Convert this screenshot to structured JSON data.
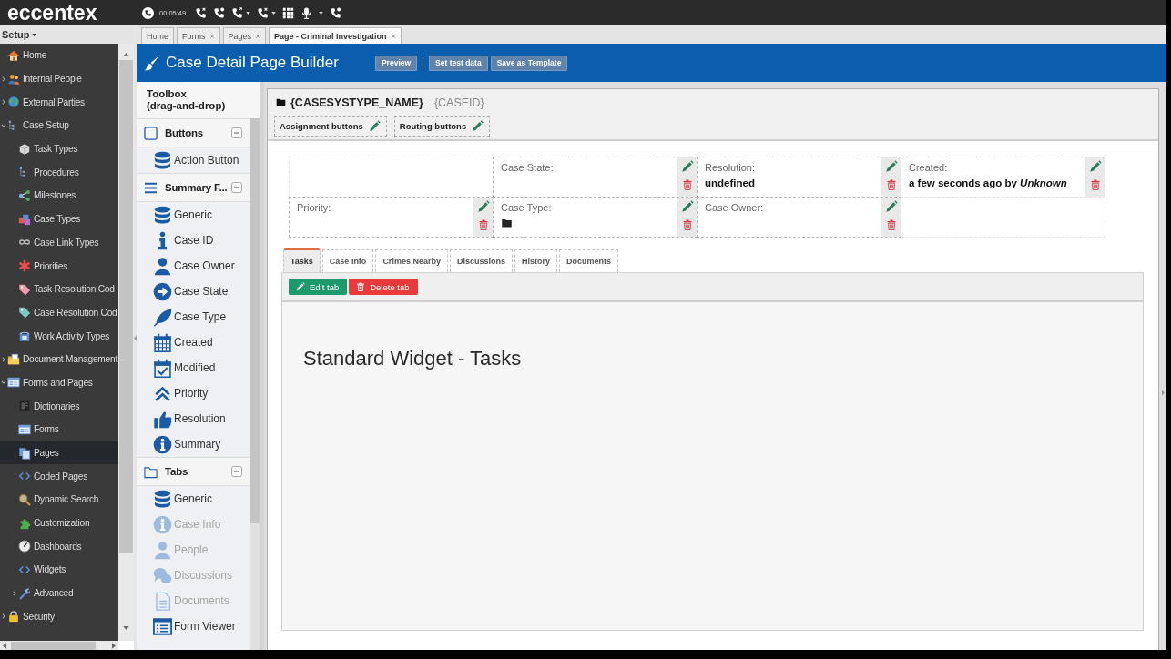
{
  "topbar": {
    "logo": "eccentex",
    "timer": "00:05:49"
  },
  "setup_menu": {
    "label": "Setup"
  },
  "sidebar": {
    "items": [
      {
        "label": "Home",
        "selected": false
      },
      {
        "label": "Internal People",
        "selected": false,
        "expanded": false
      },
      {
        "label": "External Parties",
        "selected": false,
        "expanded": false
      },
      {
        "label": "Case Setup",
        "selected": false,
        "expanded": true,
        "children": [
          {
            "label": "Task Types",
            "selected": false
          },
          {
            "label": "Procedures",
            "selected": false
          },
          {
            "label": "Milestones",
            "selected": false
          },
          {
            "label": "Case Types",
            "selected": false
          },
          {
            "label": "Case Link Types",
            "selected": false
          },
          {
            "label": "Priorities",
            "selected": false
          },
          {
            "label": "Task Resolution Cod",
            "selected": false
          },
          {
            "label": "Case Resolution Cod",
            "selected": false
          },
          {
            "label": "Work Activity Types",
            "selected": false
          }
        ]
      },
      {
        "label": "Document Management",
        "selected": false,
        "expanded": false
      },
      {
        "label": "Forms and Pages",
        "selected": false,
        "expanded": true,
        "children": [
          {
            "label": "Dictionaries",
            "selected": false
          },
          {
            "label": "Forms",
            "selected": false
          },
          {
            "label": "Pages",
            "selected": true
          },
          {
            "label": "Coded Pages",
            "selected": false
          },
          {
            "label": "Dynamic Search",
            "selected": false
          },
          {
            "label": "Customization",
            "selected": false
          },
          {
            "label": "Dashboards",
            "selected": false
          },
          {
            "label": "Widgets",
            "selected": false
          },
          {
            "label": "Advanced",
            "selected": false,
            "expanded": false
          }
        ]
      },
      {
        "label": "Security",
        "selected": false,
        "expanded": false
      }
    ]
  },
  "doc_tabs": [
    {
      "label": "Home",
      "selected": false,
      "closable": false
    },
    {
      "label": "Forms",
      "selected": false,
      "closable": true
    },
    {
      "label": "Pages",
      "selected": false,
      "closable": true
    },
    {
      "label": "Page - Criminal Investigation",
      "selected": true,
      "closable": true
    }
  ],
  "builder": {
    "title": "Case Detail Page Builder",
    "button_groups": [
      [
        "Preview"
      ],
      [
        "Set test data",
        "Save as Template"
      ]
    ]
  },
  "toolbox": {
    "title": "Toolbox",
    "subtitle": "(drag-and-drop)",
    "sections": [
      {
        "title": "Buttons",
        "expanded": true,
        "items": [
          {
            "label": "Action Button",
            "disabled": false
          }
        ]
      },
      {
        "title": "Summary F...",
        "expanded": true,
        "items": [
          {
            "label": "Generic",
            "disabled": false
          },
          {
            "label": "Case ID",
            "disabled": false
          },
          {
            "label": "Case Owner",
            "disabled": false
          },
          {
            "label": "Case State",
            "disabled": false
          },
          {
            "label": "Case Type",
            "disabled": false
          },
          {
            "label": "Created",
            "disabled": false
          },
          {
            "label": "Modified",
            "disabled": false
          },
          {
            "label": "Priority",
            "disabled": false
          },
          {
            "label": "Resolution",
            "disabled": false
          },
          {
            "label": "Summary",
            "disabled": false
          }
        ]
      },
      {
        "title": "Tabs",
        "expanded": true,
        "items": [
          {
            "label": "Generic",
            "disabled": false
          },
          {
            "label": "Case Info",
            "disabled": true
          },
          {
            "label": "People",
            "disabled": true
          },
          {
            "label": "Discussions",
            "disabled": true
          },
          {
            "label": "Documents",
            "disabled": true
          },
          {
            "label": "Form Viewer",
            "disabled": false
          }
        ]
      }
    ]
  },
  "page": {
    "title": "{CASESYSTYPE_NAME}",
    "case_id": "{CASEID}",
    "button_zones": [
      "Assignment buttons",
      "Routing buttons"
    ],
    "fields": [
      [
        {
          "kind": "empty"
        },
        {
          "kind": "field",
          "label": "Case State:"
        },
        {
          "kind": "field",
          "label": "Resolution:",
          "value": "undefined"
        },
        {
          "kind": "field",
          "label": "Created:",
          "value": "a few seconds ago by *Unknown*"
        }
      ],
      [
        {
          "kind": "field",
          "label": "Priority:"
        },
        {
          "kind": "icon-field",
          "label": "Case Type:"
        },
        {
          "kind": "field",
          "label": "Case Owner:"
        },
        {
          "kind": "empty"
        }
      ]
    ],
    "tabs": [
      {
        "label": "Tasks",
        "selected": true
      },
      {
        "label": "Case Info",
        "selected": false
      },
      {
        "label": "Crimes Nearby",
        "selected": false
      },
      {
        "label": "Discussions",
        "selected": false
      },
      {
        "label": "History",
        "selected": false
      },
      {
        "label": "Documents",
        "selected": false
      }
    ],
    "tab_buttons": [
      {
        "label": "Edit tab",
        "kind": "edit"
      },
      {
        "label": "Delete tab",
        "kind": "delete"
      }
    ],
    "widget_title": "Standard Widget - Tasks"
  }
}
